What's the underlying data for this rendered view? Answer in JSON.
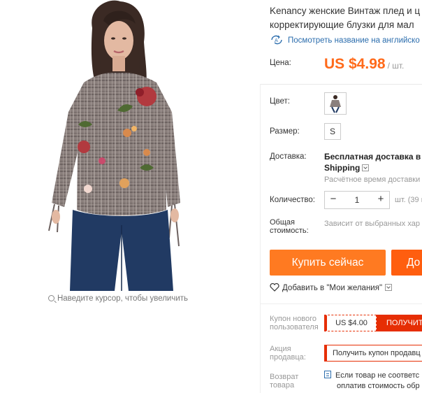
{
  "product": {
    "title_line1": "Kenancy женские Винтаж плед и ц",
    "title_line2": "корректирующие блузки для мал",
    "translate_link": "Посмотреть название на английско",
    "zoom_hint": "Наведите курсор, чтобы увеличить"
  },
  "price": {
    "label": "Цена:",
    "amount": "US $4.98",
    "unit": "/ шт."
  },
  "options": {
    "color_label": "Цвет:",
    "size_label": "Размер:",
    "size_value": "S"
  },
  "shipping": {
    "label": "Доставка:",
    "line1": "Бесплатная доставка в Ru",
    "line2": "Shipping",
    "time_note": "Расчётное время доставки"
  },
  "quantity": {
    "label": "Количество:",
    "minus": "−",
    "value": "1",
    "plus": "+",
    "unit_note": "шт. (39 ш"
  },
  "total": {
    "label_line1": "Общая",
    "label_line2": "стоимость:",
    "value": "Зависит от выбранных хар"
  },
  "actions": {
    "buy_now": "Купить сейчас",
    "add_to_cart": "До",
    "wishlist": "Добавить в \"Мои желания\""
  },
  "promo": {
    "new_user_label_1": "Купон нового",
    "new_user_label_2": "пользователя",
    "coupon_amount": "US $4.00",
    "coupon_get": "ПОЛУЧИТЬ",
    "seller_label_1": "Акция",
    "seller_label_2": "продавца:",
    "seller_button": "Получить купон продавц",
    "return_label_1": "Возврат",
    "return_label_2": "товара",
    "return_line1": "Если товар не соответс",
    "return_line2": "оплатив стоимость обр"
  },
  "colors": {
    "accent_price": "#ff6a1a",
    "buy_button": "#ff7a21",
    "cart_button": "#ff5e0f",
    "coupon_red": "#e62e04",
    "link_blue": "#2b6dad"
  },
  "icons": {
    "translate": "translate-icon",
    "magnifier": "magnifier-icon",
    "heart": "heart-icon",
    "chevron": "chevron-down-icon",
    "return": "return-policy-icon"
  }
}
